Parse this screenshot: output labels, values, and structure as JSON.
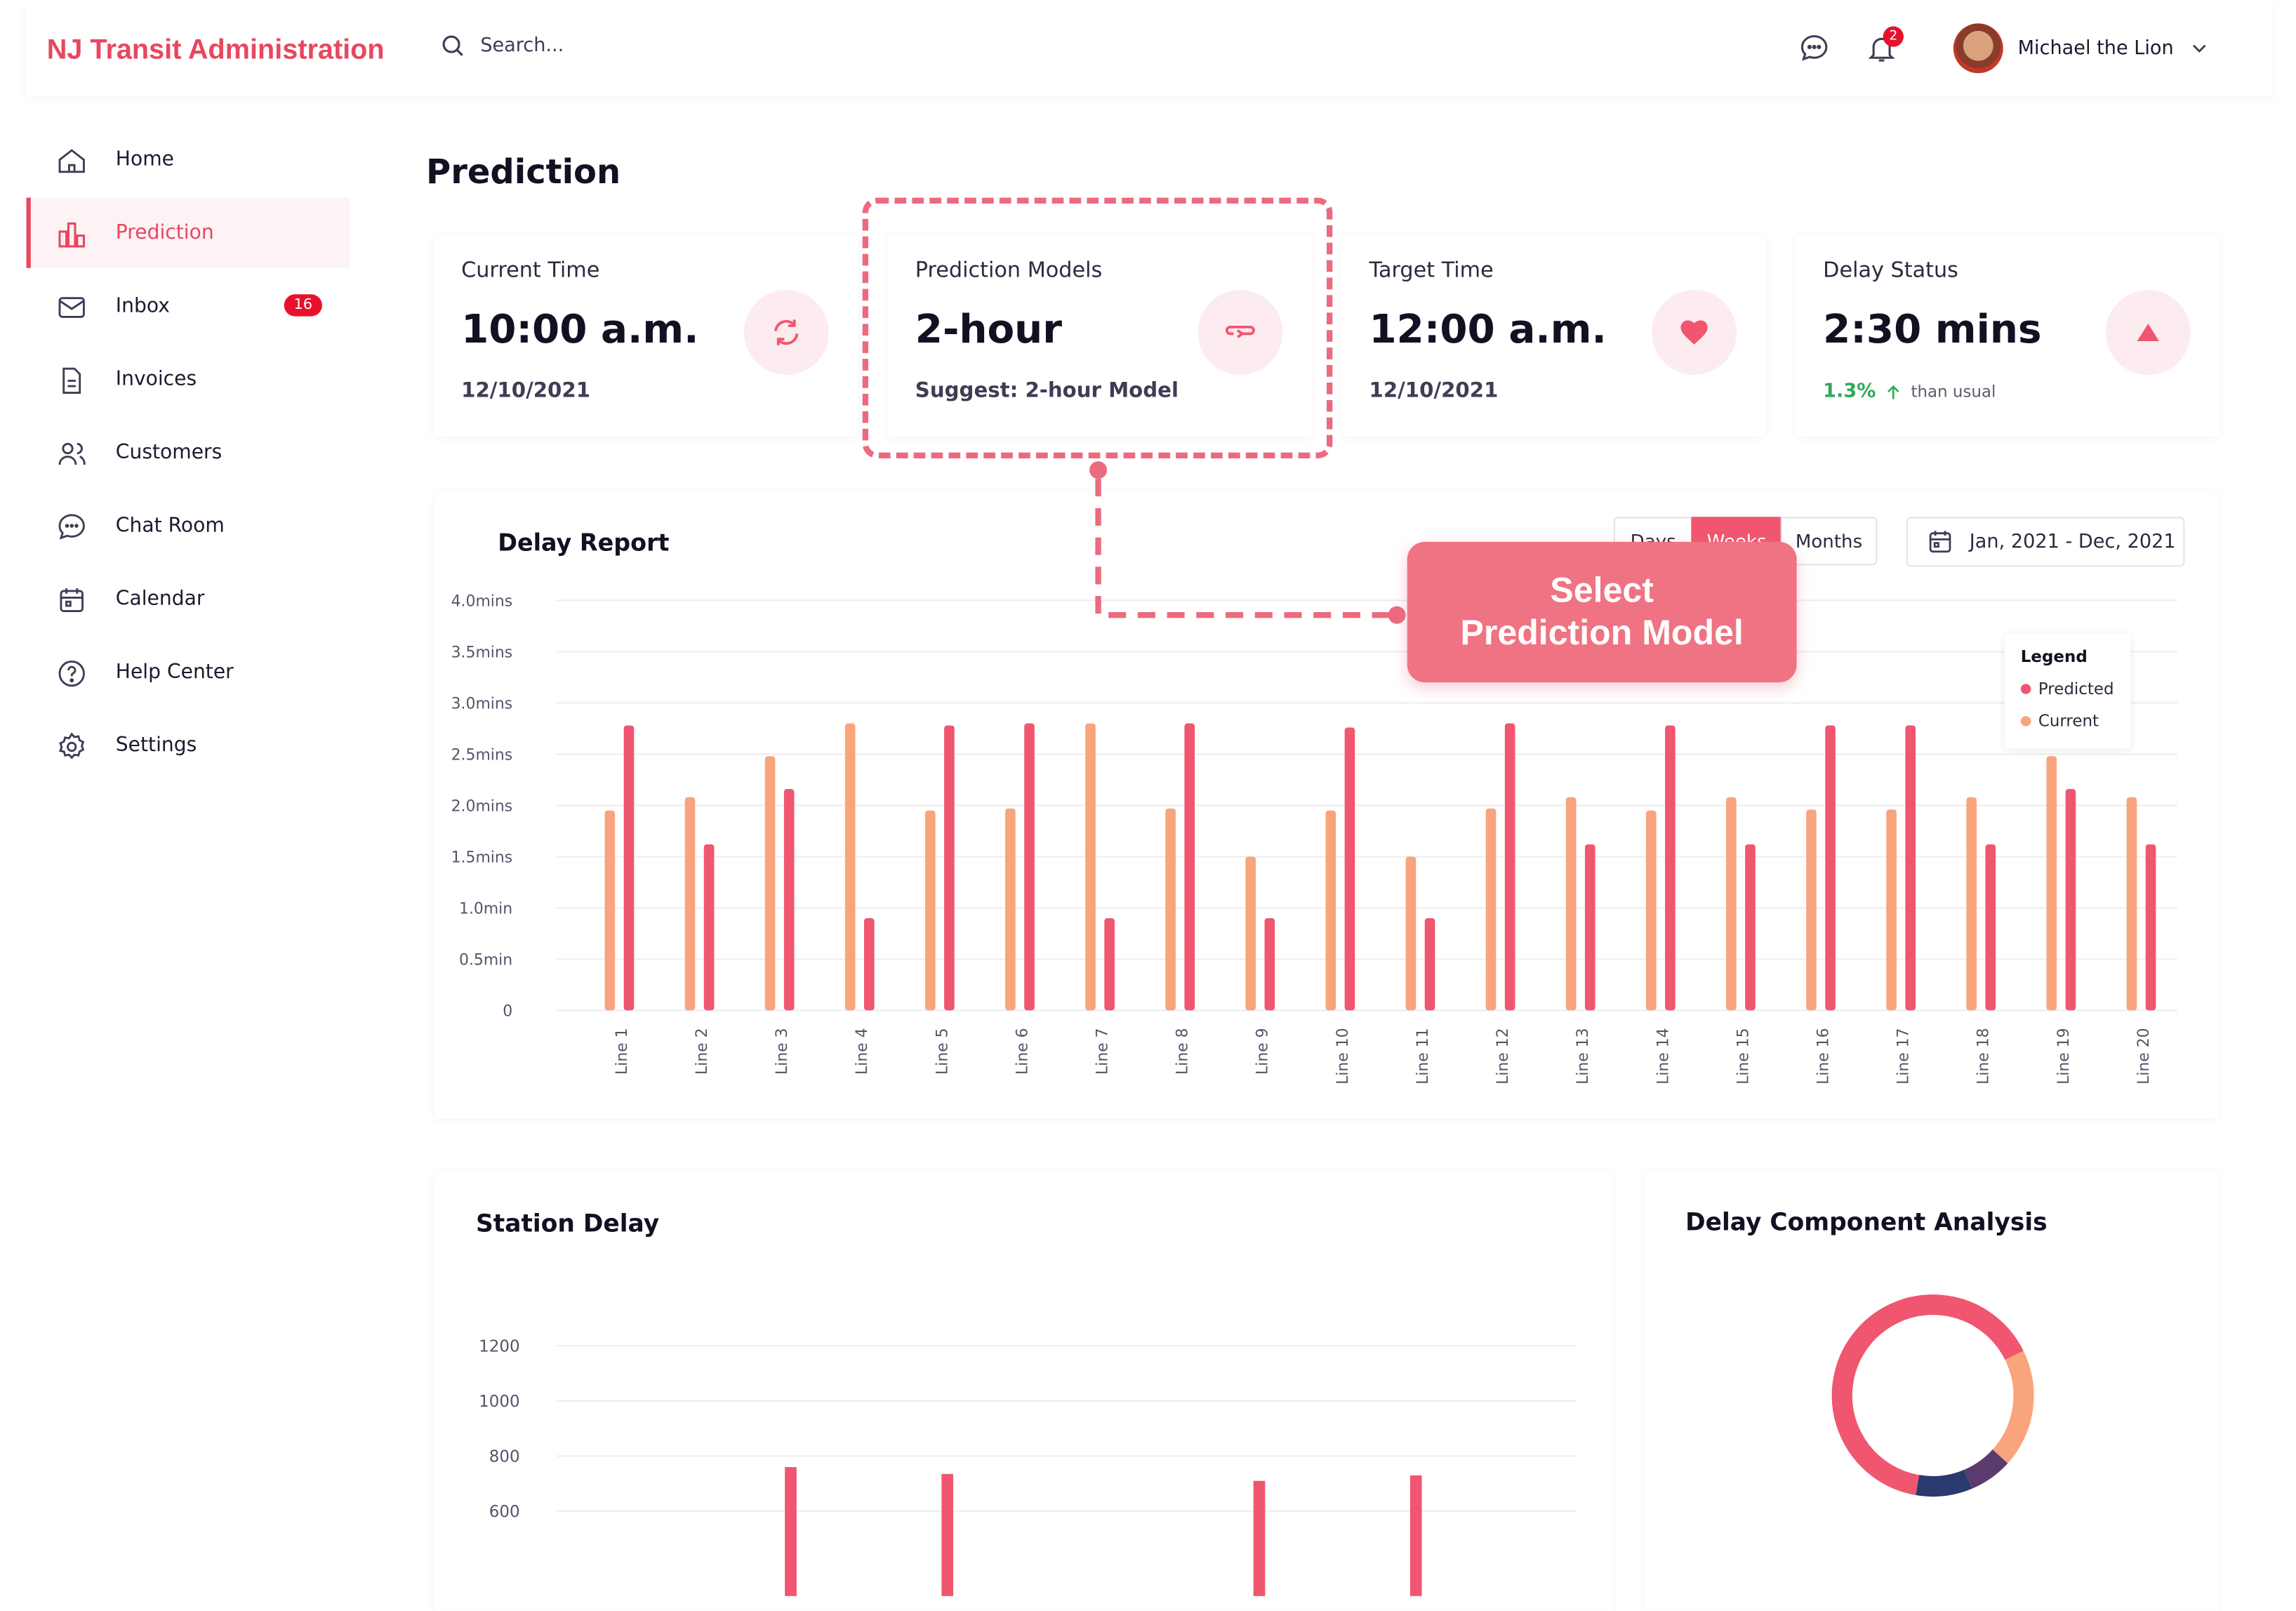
{
  "header": {
    "brand": "NJ Transit Administration",
    "search_placeholder": "Search...",
    "notification_count": "2",
    "user_name": "Michael the Lion"
  },
  "sidebar": {
    "items": [
      {
        "label": "Home",
        "icon": "home-icon"
      },
      {
        "label": "Prediction",
        "icon": "bar-chart-icon",
        "active": true
      },
      {
        "label": "Inbox",
        "icon": "mail-icon",
        "badge": "16"
      },
      {
        "label": "Invoices",
        "icon": "document-icon"
      },
      {
        "label": "Customers",
        "icon": "users-icon"
      },
      {
        "label": "Chat Room",
        "icon": "chat-icon"
      },
      {
        "label": "Calendar",
        "icon": "calendar-icon"
      },
      {
        "label": "Help Center",
        "icon": "help-icon"
      },
      {
        "label": "Settings",
        "icon": "gear-icon"
      }
    ]
  },
  "page": {
    "title": "Prediction"
  },
  "cards": [
    {
      "label": "Current Time",
      "value": "10:00 a.m.",
      "sub": "12/10/2021",
      "icon": "refresh-icon"
    },
    {
      "label": "Prediction Models",
      "value": "2-hour",
      "sub": "Suggest: 2-hour Model",
      "icon": "loop-icon"
    },
    {
      "label": "Target Time",
      "value": "12:00 a.m.",
      "sub": "12/10/2021",
      "icon": "heart-icon"
    },
    {
      "label": "Delay Status",
      "value": "2:30 mins",
      "trend_pct": "1.3%",
      "trend_text": "than usual",
      "icon": "triangle-up-icon"
    }
  ],
  "callout": {
    "line1": "Select",
    "line2": "Prediction Model"
  },
  "delay_report": {
    "title": "Delay Report",
    "range_buttons": [
      "Days",
      "Weeks",
      "Months"
    ],
    "selected_range": "Weeks",
    "date_range": "Jan, 2021 - Dec, 2021",
    "legend_title": "Legend"
  },
  "station_delay": {
    "title": "Station Delay"
  },
  "component_analysis": {
    "title": "Delay Component Analysis"
  },
  "colors": {
    "accent": "#e8475f",
    "predicted": "#f0566f",
    "current": "#f9a47c",
    "navy": "#283a6e",
    "purple": "#5b3a6e"
  },
  "chart_data": [
    {
      "type": "bar",
      "title": "Delay Report",
      "categories": [
        "Line 1",
        "Line 2",
        "Line 3",
        "Line 4",
        "Line 5",
        "Line 6",
        "Line 7",
        "Line 8",
        "Line 9",
        "Line 10",
        "Line 11",
        "Line 12",
        "Line 13",
        "Line 14",
        "Line 15",
        "Line 16",
        "Line 17",
        "Line 18",
        "Line 19",
        "Line 20"
      ],
      "y_ticks": [
        "0",
        "0.5min",
        "1.0min",
        "1.5mins",
        "2.0mins",
        "2.5mins",
        "3.0mins",
        "3.5mins",
        "4.0mins"
      ],
      "ylim": [
        0,
        4.0
      ],
      "legend": "top-right",
      "series": [
        {
          "name": "Current",
          "values": [
            1.95,
            2.08,
            2.48,
            2.8,
            1.95,
            1.97,
            2.8,
            1.97,
            1.5,
            1.95,
            1.5,
            1.97,
            2.08,
            1.95,
            2.08,
            1.96,
            1.96,
            2.08,
            2.48,
            2.08
          ]
        },
        {
          "name": "Predicted",
          "values": [
            2.78,
            1.62,
            2.16,
            0.9,
            2.78,
            2.8,
            0.9,
            2.8,
            0.9,
            2.76,
            0.9,
            2.8,
            1.62,
            2.78,
            1.62,
            2.78,
            2.78,
            1.62,
            2.16,
            1.62
          ]
        }
      ]
    },
    {
      "type": "bar",
      "title": "Station Delay",
      "y_ticks": [
        "600",
        "800",
        "1000",
        "1200"
      ],
      "ylim": [
        600,
        1200
      ],
      "values": [
        760,
        735,
        710,
        730
      ]
    },
    {
      "type": "pie",
      "title": "Delay Component Analysis",
      "slices": [
        {
          "value": 65,
          "color": "#f0566f"
        },
        {
          "value": 19,
          "color": "#f9a47c"
        },
        {
          "value": 7,
          "color": "#5b3a6e"
        },
        {
          "value": 9,
          "color": "#283a6e"
        }
      ]
    }
  ]
}
